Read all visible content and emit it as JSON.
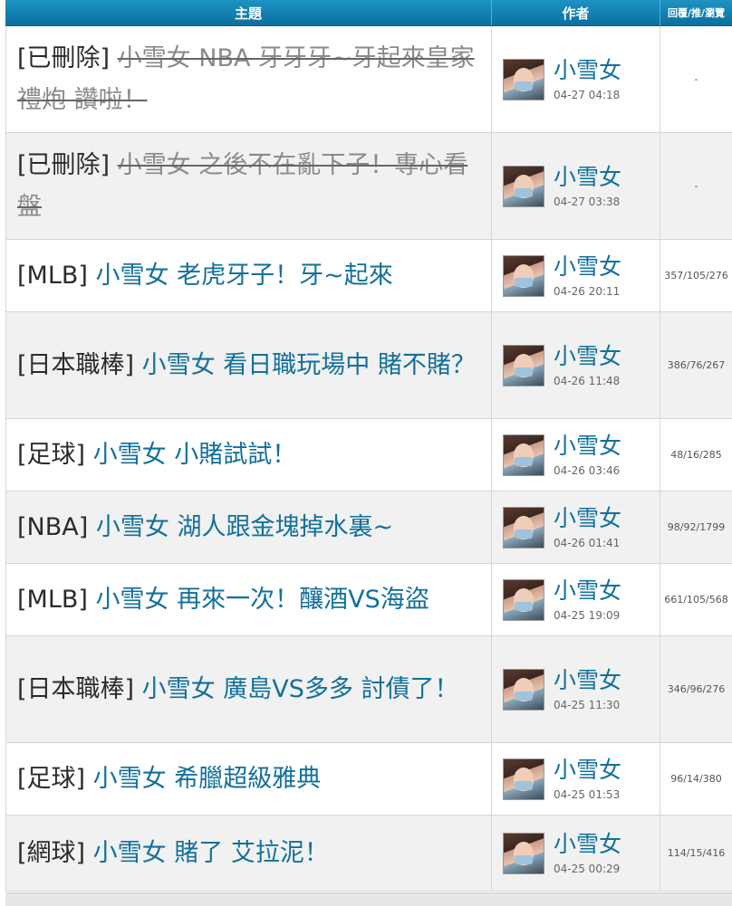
{
  "header": {
    "topic": "主題",
    "author": "作者",
    "stats": "回覆/推/瀏覽"
  },
  "rows": [
    {
      "category": "[已刪除]",
      "title": "小雪女 NBA 牙牙牙~牙起來皇家禮炮 讚啦！",
      "deleted": true,
      "author": "小雪女",
      "time": "04-27 04:18",
      "stats": "-"
    },
    {
      "category": "[已刪除]",
      "title": "小雪女 之後不在亂下子！專心看盤",
      "deleted": true,
      "author": "小雪女",
      "time": "04-27 03:38",
      "stats": "-"
    },
    {
      "category": "[MLB]",
      "title": "小雪女 老虎牙子！牙~起來",
      "deleted": false,
      "author": "小雪女",
      "time": "04-26 20:11",
      "stats": "357/105/276"
    },
    {
      "category": "[日本職棒]",
      "title": "小雪女 看日職玩場中 賭不賭？",
      "deleted": false,
      "author": "小雪女",
      "time": "04-26 11:48",
      "stats": "386/76/267"
    },
    {
      "category": "[足球]",
      "title": "小雪女 小賭試試！",
      "deleted": false,
      "author": "小雪女",
      "time": "04-26 03:46",
      "stats": "48/16/285"
    },
    {
      "category": "[NBA]",
      "title": "小雪女 湖人跟金塊掉水裏~",
      "deleted": false,
      "author": "小雪女",
      "time": "04-26 01:41",
      "stats": "98/92/1799"
    },
    {
      "category": "[MLB]",
      "title": "小雪女 再來一次！釀酒VS海盜",
      "deleted": false,
      "author": "小雪女",
      "time": "04-25 19:09",
      "stats": "661/105/568"
    },
    {
      "category": "[日本職棒]",
      "title": "小雪女 廣島VS多多 討債了！",
      "deleted": false,
      "author": "小雪女",
      "time": "04-25 11:30",
      "stats": "346/96/276"
    },
    {
      "category": "[足球]",
      "title": "小雪女 希臘超級雅典",
      "deleted": false,
      "author": "小雪女",
      "time": "04-25 01:53",
      "stats": "96/14/380"
    },
    {
      "category": "[網球]",
      "title": "小雪女 賭了 艾拉泥！",
      "deleted": false,
      "author": "小雪女",
      "time": "04-25 00:29",
      "stats": "114/15/416"
    }
  ]
}
